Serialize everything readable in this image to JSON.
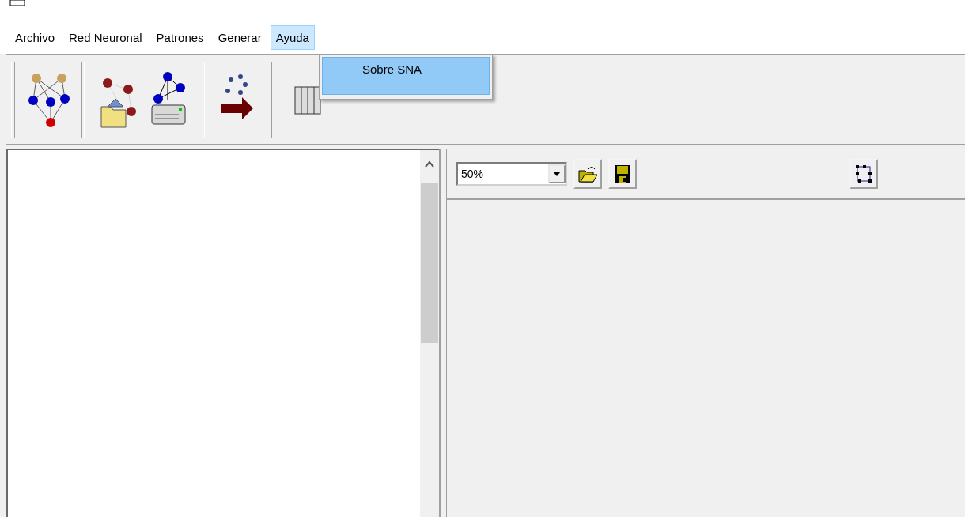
{
  "menu_bar": [
    {
      "label": "Archivo",
      "selected": false
    },
    {
      "label": "Red Neuronal",
      "selected": false
    },
    {
      "label": "Patrones",
      "selected": false
    },
    {
      "label": "Generar",
      "selected": false
    },
    {
      "label": "Ayuda",
      "selected": true
    }
  ],
  "open_menu": {
    "items": [
      {
        "label": "Sobre SNA",
        "selected": true
      }
    ]
  },
  "right_panel": {
    "zoom_combo": {
      "value": "50%"
    }
  }
}
